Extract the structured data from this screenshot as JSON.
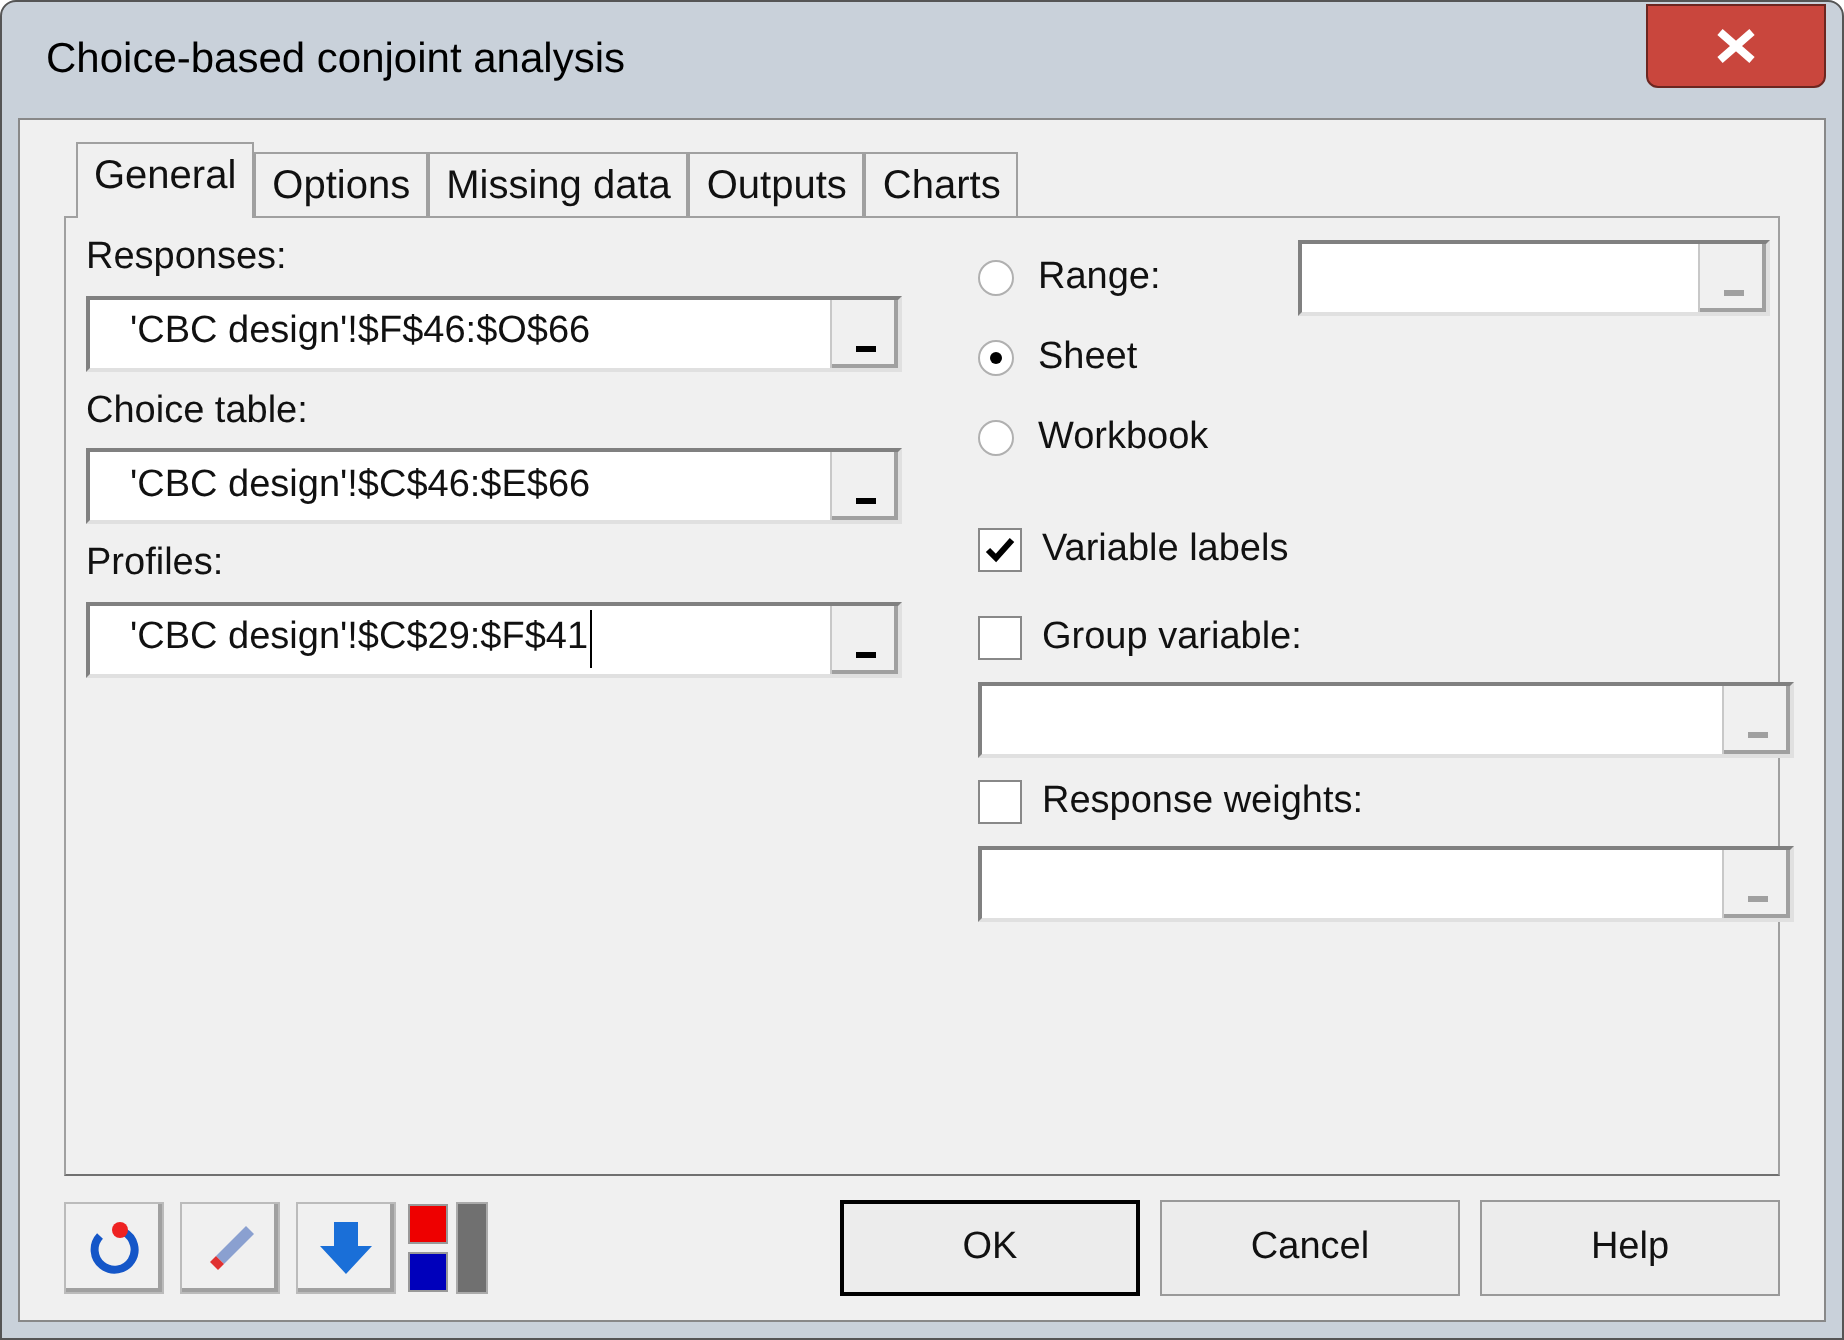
{
  "window": {
    "title": "Choice-based conjoint analysis"
  },
  "tabs": [
    {
      "label": "General",
      "selected": true
    },
    {
      "label": "Options",
      "selected": false
    },
    {
      "label": "Missing data",
      "selected": false
    },
    {
      "label": "Outputs",
      "selected": false
    },
    {
      "label": "Charts",
      "selected": false
    }
  ],
  "left_fields": [
    {
      "label": "Responses:",
      "value": "'CBC design'!$F$46:$O$66"
    },
    {
      "label": "Choice table:",
      "value": "'CBC design'!$C$46:$E$66"
    },
    {
      "label": "Profiles:",
      "value": "'CBC design'!$C$29:$F$41"
    }
  ],
  "radios": [
    {
      "label": "Range:",
      "selected": false
    },
    {
      "label": "Sheet",
      "selected": true
    },
    {
      "label": "Workbook",
      "selected": false
    }
  ],
  "checkboxes": [
    {
      "label": "Variable labels",
      "checked": true,
      "has_field": false
    },
    {
      "label": "Group variable:",
      "checked": false,
      "has_field": true
    },
    {
      "label": "Response weights:",
      "checked": false,
      "has_field": true
    }
  ],
  "buttons": [
    {
      "label": "OK",
      "default": true
    },
    {
      "label": "Cancel",
      "default": false
    },
    {
      "label": "Help",
      "default": false
    }
  ]
}
